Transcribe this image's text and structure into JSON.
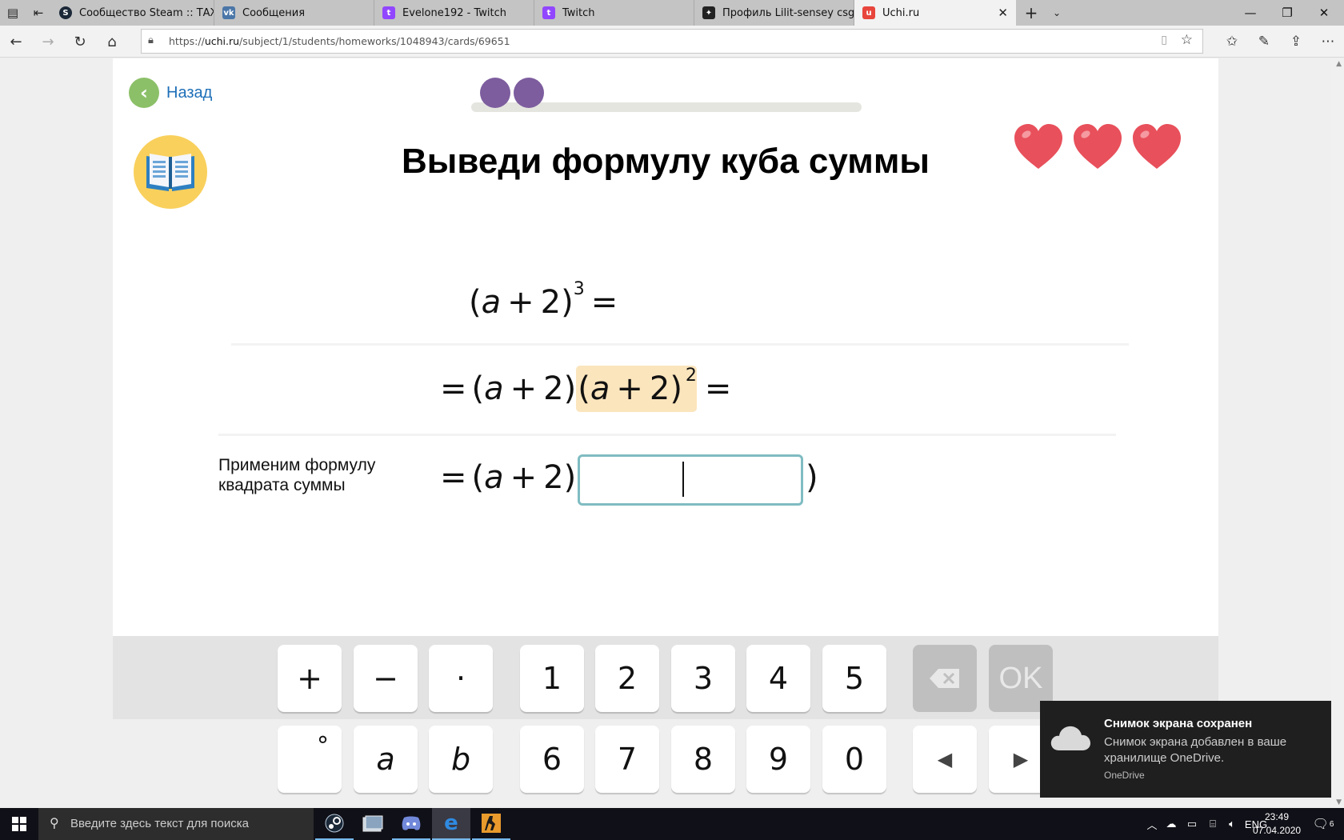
{
  "browser": {
    "tabs": [
      {
        "label": "Сообщество Steam :: ТАЖИ",
        "icon": "steam-icon",
        "color": "#1b2838"
      },
      {
        "label": "Сообщения",
        "icon": "vk-icon",
        "color": "#4a76a8"
      },
      {
        "label": "Evelone192 - Twitch",
        "icon": "twitch-icon",
        "color": "#9146ff"
      },
      {
        "label": "Twitch",
        "icon": "twitch-icon",
        "color": "#9146ff"
      },
      {
        "label": "Профиль Lilit-sensey csgo.r",
        "icon": "csgo-icon",
        "color": "#222222"
      },
      {
        "label": "Uchi.ru",
        "icon": "uchi-icon",
        "color": "#e8453c",
        "active": true
      }
    ],
    "url_prefix": "https://",
    "url_domain": "uchi.ru",
    "url_path": "/subject/1/students/homeworks/1048943/cards/69651"
  },
  "page": {
    "back_label": "Назад",
    "progress": {
      "done": 2
    },
    "title": "Выведи формулу куба суммы",
    "lives": 3,
    "colors": {
      "accent_green": "#8cc068",
      "progress_purple": "#7d5d9e",
      "heart": "#e8505b",
      "highlight": "#fbe5bd",
      "input_border": "#7fbcc2"
    },
    "row1": {
      "lp": "(",
      "var": "a",
      "op": "+",
      "num": "2",
      "rp": ")",
      "exp": "3",
      "eq": "="
    },
    "row2": {
      "eq": "=",
      "lp": "(",
      "var": "a",
      "op": "+",
      "num": "2",
      "rp": ")",
      "hl_lp": "(",
      "hl_var": "a",
      "hl_op": "+",
      "hl_num": "2",
      "hl_rp": ")",
      "exp": "2",
      "eq2": "="
    },
    "row3": {
      "hint_line1": "Применим формулу",
      "hint_line2": "квадрата суммы",
      "eq": "=",
      "lp": "(",
      "var": "a",
      "op": "+",
      "num": "2",
      "rp": ")",
      "open": "(",
      "close": ")",
      "input_value": ""
    }
  },
  "keypad": {
    "row1": [
      "+",
      "−",
      "·",
      "1",
      "2",
      "3",
      "4",
      "5"
    ],
    "row2": [
      "°",
      "a",
      "b",
      "6",
      "7",
      "8",
      "9",
      "0"
    ],
    "backspace": "⌫",
    "ok": "OK",
    "left": "◀",
    "right": "▶"
  },
  "toast": {
    "title": "Снимок экрана сохранен",
    "body": "Снимок экрана добавлен в ваше хранилище OneDrive.",
    "app": "OneDrive"
  },
  "taskbar": {
    "search_placeholder": "Введите здесь текст для поиска",
    "lang": "ENG",
    "time": "23:49",
    "date": "07.04.2020",
    "notifications": "6"
  }
}
